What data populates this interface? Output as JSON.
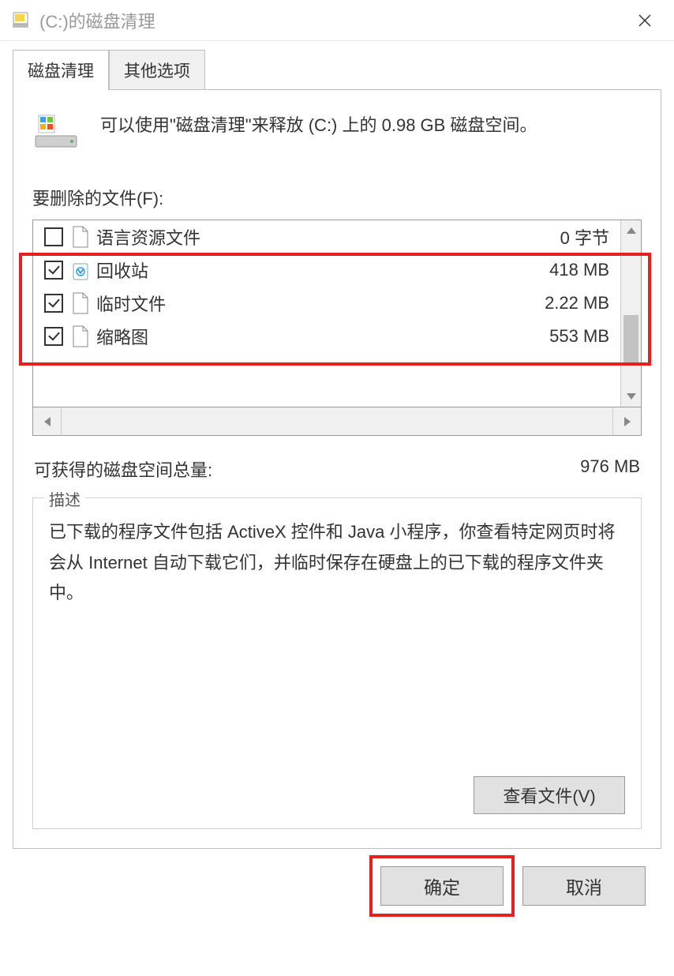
{
  "window": {
    "title": "(C:)的磁盘清理"
  },
  "tabs": {
    "tab1": "磁盘清理",
    "tab2": "其他选项"
  },
  "info": {
    "text": "可以使用\"磁盘清理\"来释放  (C:) 上的 0.98 GB 磁盘空间。"
  },
  "filesSection": {
    "label": "要删除的文件(F):"
  },
  "files": [
    {
      "checked": false,
      "icon": "file",
      "label": "语言资源文件",
      "size": "0 字节"
    },
    {
      "checked": true,
      "icon": "recycle",
      "label": "回收站",
      "size": "418 MB"
    },
    {
      "checked": true,
      "icon": "file",
      "label": "临时文件",
      "size": "2.22 MB"
    },
    {
      "checked": true,
      "icon": "file",
      "label": "缩略图",
      "size": "553 MB"
    }
  ],
  "total": {
    "label": "可获得的磁盘空间总量:",
    "value": "976 MB"
  },
  "description": {
    "legend": "描述",
    "text": "已下载的程序文件包括 ActiveX 控件和 Java 小程序，你查看特定网页时将会从 Internet 自动下载它们，并临时保存在硬盘上的已下载的程序文件夹中。"
  },
  "buttons": {
    "viewFiles": "查看文件(V)",
    "ok": "确定",
    "cancel": "取消"
  }
}
